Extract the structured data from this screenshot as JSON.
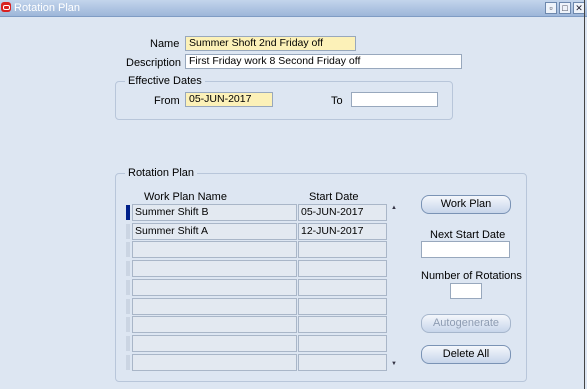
{
  "window": {
    "title": "Rotation Plan",
    "minimize": "▫",
    "maximize": "□",
    "close": "✕"
  },
  "form": {
    "name_label": "Name",
    "name_value": "Summer Shoft 2nd Friday off",
    "description_label": "Description",
    "description_value": "First Friday work 8 Second Friday off",
    "effective_dates_title": "Effective Dates",
    "from_label": "From",
    "from_value": "05-JUN-2017",
    "to_label": "To",
    "to_value": ""
  },
  "rotation_plan": {
    "title": "Rotation Plan",
    "columns": [
      "Work Plan Name",
      "Start Date"
    ],
    "rows": [
      {
        "work_plan": "Summer Shift B",
        "start_date": "05-JUN-2017"
      },
      {
        "work_plan": "Summer Shift A",
        "start_date": "12-JUN-2017"
      },
      {
        "work_plan": "",
        "start_date": ""
      },
      {
        "work_plan": "",
        "start_date": ""
      },
      {
        "work_plan": "",
        "start_date": ""
      },
      {
        "work_plan": "",
        "start_date": ""
      },
      {
        "work_plan": "",
        "start_date": ""
      },
      {
        "work_plan": "",
        "start_date": ""
      },
      {
        "work_plan": "",
        "start_date": ""
      }
    ],
    "work_plan_button": "Work Plan",
    "next_start_date_label": "Next Start Date",
    "next_start_date_value": "",
    "number_of_rotations_label": "Number of Rotations",
    "number_of_rotations_value": "",
    "autogenerate_button": "Autogenerate",
    "delete_all_button": "Delete All"
  },
  "colors": {
    "required_field": "#fcf1b8",
    "background": "#dde6f2",
    "title_bar": "#9db6d9",
    "current_row": "#00208a"
  }
}
